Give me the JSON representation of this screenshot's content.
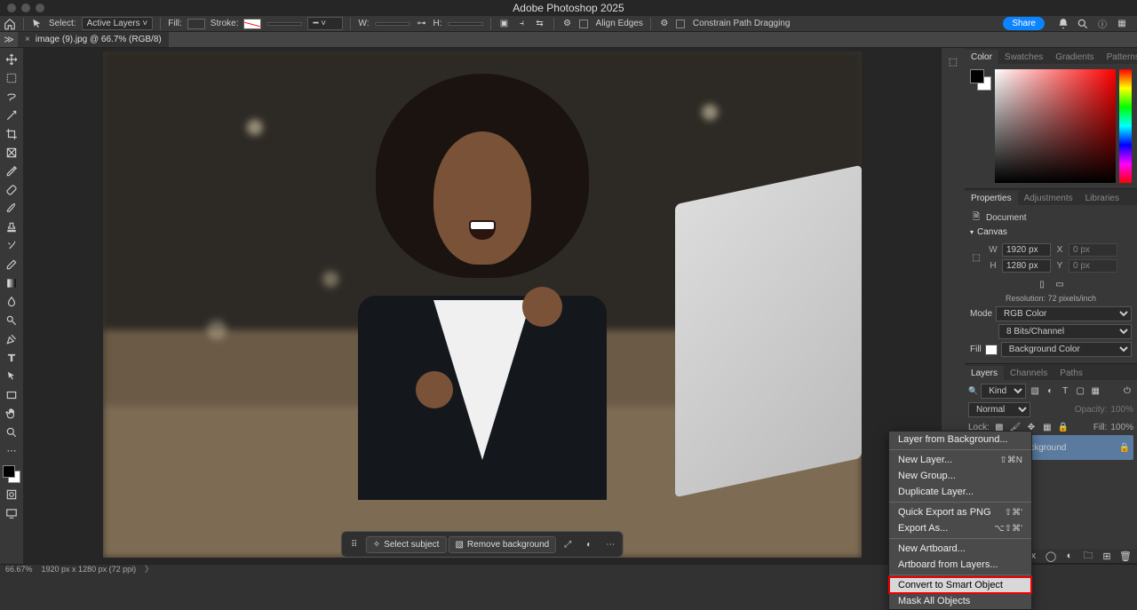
{
  "app": {
    "title": "Adobe Photoshop 2025"
  },
  "options": {
    "select_label": "Select:",
    "select_value": "Active Layers",
    "fill_label": "Fill:",
    "stroke_label": "Stroke:",
    "w_label": "W:",
    "h_label": "H:",
    "align_edges": "Align Edges",
    "constrain": "Constrain Path Dragging",
    "share": "Share"
  },
  "doc": {
    "tab_left": "≫",
    "name": "image (9).jpg @ 66.7% (RGB/8)"
  },
  "ctxbar": {
    "select_subject": "Select subject",
    "remove_bg": "Remove background"
  },
  "panels": {
    "color_tabs": [
      "Color",
      "Swatches",
      "Gradients",
      "Patterns"
    ],
    "prop_tabs": [
      "Properties",
      "Adjustments",
      "Libraries"
    ],
    "doc_label": "Document",
    "canvas_label": "Canvas",
    "w": "1920 px",
    "h": "1280 px",
    "x_label": "X",
    "y_label": "Y",
    "x": "0 px",
    "y": "0 px",
    "resolution": "Resolution: 72 pixels/inch",
    "mode_label": "Mode",
    "mode": "RGB Color",
    "depth": "8 Bits/Channel",
    "fill_label": "Fill",
    "fill": "Background Color",
    "layer_tabs": [
      "Layers",
      "Channels",
      "Paths"
    ],
    "kind": "Kind",
    "blend": "Normal",
    "opacity_label": "Opacity:",
    "opacity": "100%",
    "lock_label": "Lock:",
    "fill_pct_label": "Fill:",
    "fill_pct": "100%",
    "bg_layer": "Background"
  },
  "menu": {
    "items": [
      {
        "t": "Layer from Background...",
        "s": ""
      },
      {
        "sep": true
      },
      {
        "t": "New Layer...",
        "s": "⇧⌘N"
      },
      {
        "t": "New Group...",
        "s": ""
      },
      {
        "t": "Duplicate Layer...",
        "s": ""
      },
      {
        "sep": true
      },
      {
        "t": "Quick Export as PNG",
        "s": "⇧⌘'"
      },
      {
        "t": "Export As...",
        "s": "⌥⇧⌘'"
      },
      {
        "sep": true
      },
      {
        "t": "New Artboard...",
        "s": ""
      },
      {
        "t": "Artboard from Layers...",
        "s": ""
      },
      {
        "sep": true
      },
      {
        "t": "Convert to Smart Object",
        "s": "",
        "hl": true
      },
      {
        "t": "Mask All Objects",
        "s": ""
      }
    ]
  },
  "status": {
    "zoom": "66.67%",
    "dims": "1920 px x 1280 px (72 ppi)",
    "arrow": "〉"
  }
}
